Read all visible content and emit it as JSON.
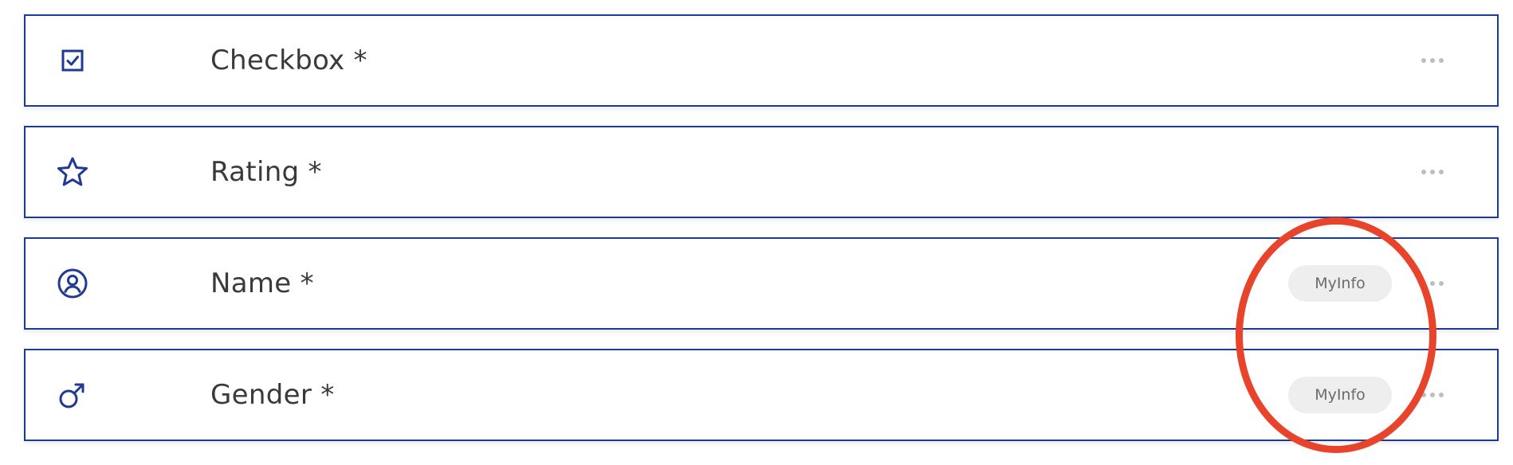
{
  "fields": [
    {
      "label": "Checkbox *",
      "icon": "checkbox-icon",
      "badge": ""
    },
    {
      "label": "Rating *",
      "icon": "star-icon",
      "badge": ""
    },
    {
      "label": "Name *",
      "icon": "user-circle-icon",
      "badge": "MyInfo"
    },
    {
      "label": "Gender *",
      "icon": "male-symbol-icon",
      "badge": "MyInfo"
    }
  ],
  "colors": {
    "accent": "#1f3a93",
    "label_text": "#3a3a3a",
    "badge_bg": "#eeeeee",
    "badge_text": "#6b6b6b",
    "annotation": "#e8442b"
  }
}
